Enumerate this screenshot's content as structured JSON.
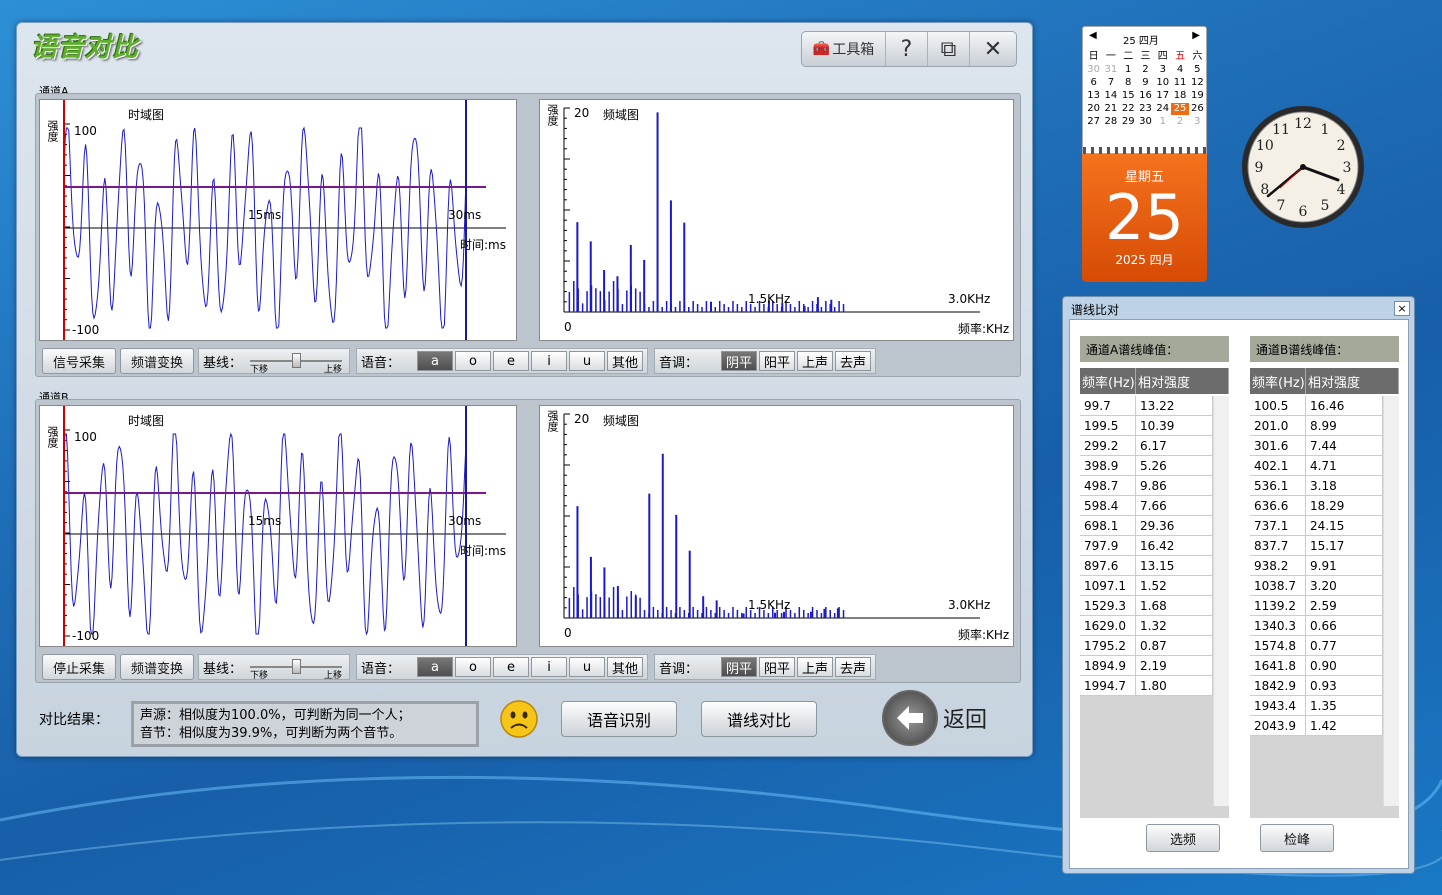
{
  "app": {
    "title": "语音对比"
  },
  "toolbar": {
    "toolbox": "工具箱",
    "help": "?",
    "restore": "⧉",
    "close": "✕"
  },
  "channel_a": {
    "label": "通道A",
    "time_plot": {
      "title": "时域图",
      "ylabel": "强度",
      "ymax": "100",
      "ymin": "-100",
      "mid_tick": "15ms",
      "end_tick": "30ms",
      "xlabel": "时间:ms"
    },
    "freq_plot": {
      "title": "频域图",
      "ylabel": "强度",
      "ymax": "20",
      "zero": "0",
      "mid_tick": "1.5KHz",
      "end_tick": "3.0KHz",
      "xlabel": "频率:KHz"
    },
    "controls": {
      "btn1": "信号采集",
      "btn2": "频谱变换",
      "baseline": "基线：",
      "down": "下移",
      "up": "上移",
      "vowel_label": "语音：",
      "vowels": [
        "a",
        "o",
        "e",
        "i",
        "u",
        "其他"
      ],
      "tone_label": "音调：",
      "tones": [
        "阴平",
        "阳平",
        "上声",
        "去声"
      ]
    }
  },
  "channel_b": {
    "label": "通道B",
    "time_plot": {
      "title": "时域图",
      "ylabel": "强度",
      "ymax": "100",
      "ymin": "-100",
      "mid_tick": "15ms",
      "end_tick": "30ms",
      "xlabel": "时间:ms"
    },
    "freq_plot": {
      "title": "频域图",
      "ylabel": "强度",
      "ymax": "20",
      "zero": "0",
      "mid_tick": "1.5KHz",
      "end_tick": "3.0KHz",
      "xlabel": "频率:KHz"
    },
    "controls": {
      "btn1": "停止采集",
      "btn2": "频谱变换",
      "baseline": "基线：",
      "down": "下移",
      "up": "上移",
      "vowel_label": "语音：",
      "vowels": [
        "a",
        "o",
        "e",
        "i",
        "u",
        "其他"
      ],
      "tone_label": "音调：",
      "tones": [
        "阴平",
        "阳平",
        "上声",
        "去声"
      ]
    }
  },
  "result": {
    "label": "对比结果：",
    "line1": "声源：相似度为100.0%，可判断为同一个人；",
    "line2": "音节：相似度为39.9%，可判断为两个音节。",
    "btn_recognize": "语音识别",
    "btn_compare": "谱线对比",
    "btn_back": "返回"
  },
  "calendar": {
    "header": "25 四月",
    "weekdays": [
      "日",
      "一",
      "二",
      "三",
      "四",
      "五",
      "六"
    ],
    "days": [
      "30",
      "31",
      "1",
      "2",
      "3",
      "4",
      "5",
      "6",
      "7",
      "8",
      "9",
      "10",
      "11",
      "12",
      "13",
      "14",
      "15",
      "16",
      "17",
      "18",
      "19",
      "20",
      "21",
      "22",
      "23",
      "24",
      "25",
      "26",
      "27",
      "28",
      "29",
      "30",
      "1",
      "2",
      "3"
    ],
    "weekday_text": "星期五",
    "day": "25",
    "month_text": "2025 四月"
  },
  "clock": {
    "numbers": [
      "12",
      "1",
      "2",
      "3",
      "4",
      "5",
      "6",
      "7",
      "8",
      "9",
      "10",
      "11"
    ]
  },
  "spectrum_window": {
    "title": "谱线比对",
    "close": "×",
    "a_header": "通道A谱线峰值：",
    "b_header": "通道B谱线峰值：",
    "col_freq": "频率(Hz)",
    "col_int": "相对强度",
    "a_rows": [
      [
        "99.7",
        "13.22"
      ],
      [
        "199.5",
        "10.39"
      ],
      [
        "299.2",
        "6.17"
      ],
      [
        "398.9",
        "5.26"
      ],
      [
        "498.7",
        "9.86"
      ],
      [
        "598.4",
        "7.66"
      ],
      [
        "698.1",
        "29.36"
      ],
      [
        "797.9",
        "16.42"
      ],
      [
        "897.6",
        "13.15"
      ],
      [
        "1097.1",
        "1.52"
      ],
      [
        "1529.3",
        "1.68"
      ],
      [
        "1629.0",
        "1.32"
      ],
      [
        "1795.2",
        "0.87"
      ],
      [
        "1894.9",
        "2.19"
      ],
      [
        "1994.7",
        "1.80"
      ]
    ],
    "b_rows": [
      [
        "100.5",
        "16.46"
      ],
      [
        "201.0",
        "8.99"
      ],
      [
        "301.6",
        "7.44"
      ],
      [
        "402.1",
        "4.71"
      ],
      [
        "536.1",
        "3.18"
      ],
      [
        "636.6",
        "18.29"
      ],
      [
        "737.1",
        "24.15"
      ],
      [
        "837.7",
        "15.17"
      ],
      [
        "938.2",
        "9.91"
      ],
      [
        "1038.7",
        "3.20"
      ],
      [
        "1139.2",
        "2.59"
      ],
      [
        "1340.3",
        "0.66"
      ],
      [
        "1574.8",
        "0.77"
      ],
      [
        "1641.8",
        "0.90"
      ],
      [
        "1842.9",
        "0.93"
      ],
      [
        "1943.4",
        "1.35"
      ],
      [
        "2043.9",
        "1.42"
      ]
    ],
    "btn_options": "选频",
    "btn_peaks": "检峰"
  },
  "colors": {
    "wave": "#1a1acc",
    "spectrum": "#1a1acc",
    "baseline": "#7a1a8a",
    "cursor_left": "#cc0000",
    "cursor_right": "#1a1a99",
    "calendar_orange": "#e85a0c"
  }
}
